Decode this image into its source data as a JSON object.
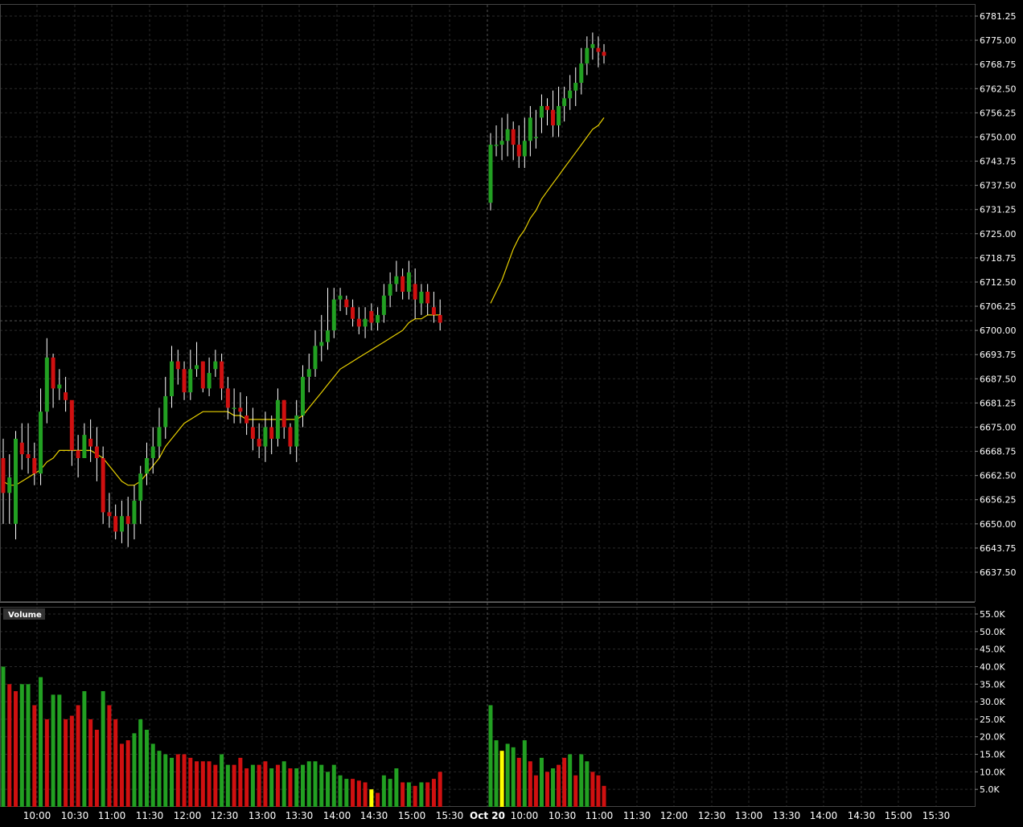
{
  "colors": {
    "background": "#000000",
    "grid": "#2a2a2a",
    "up": "#22a022",
    "down": "#d01010",
    "volume_highlight": "#ffff00",
    "ma_line": "#e8d000",
    "wick": "#ffffff",
    "crosshair": "#555555"
  },
  "chart_data": [
    {
      "type": "candlestick",
      "ylim": [
        6631.25,
        6784.375
      ],
      "yticks": [
        "6781.25",
        "6775.00",
        "6768.75",
        "6762.50",
        "6756.25",
        "6750.00",
        "6743.75",
        "6737.50",
        "6731.25",
        "6725.00",
        "6718.75",
        "6712.50",
        "6706.25",
        "6700.00",
        "6693.75",
        "6687.50",
        "6681.25",
        "6675.00",
        "6668.75",
        "6662.50",
        "6656.25",
        "6650.00",
        "6643.75",
        "6637.50"
      ],
      "grid": true,
      "crosshair_price": 6702.5,
      "candles_day1": {
        "open": [
          6667,
          6658,
          6650,
          6671,
          6668,
          6667,
          6663,
          6679,
          6693,
          6685,
          6684,
          6682,
          6669,
          6667,
          6672,
          6670,
          6667,
          6653,
          6652,
          6648,
          6652,
          6650,
          6656,
          6663,
          6667,
          6670,
          6675,
          6683,
          6692,
          6690,
          6684,
          6690,
          6692,
          6685,
          6690,
          6692,
          6685,
          6680,
          6680,
          6678,
          6675,
          6672,
          6670,
          6675,
          6672,
          6682,
          6675,
          6670,
          6678,
          6688,
          6690,
          6696,
          6697,
          6700,
          6708,
          6708,
          6706,
          6703,
          6701,
          6705,
          6702,
          6704,
          6709,
          6712,
          6714,
          6710,
          6712,
          6707,
          6710,
          6706,
          6704
        ],
        "close": [
          6658,
          6662,
          6672,
          6668,
          6667,
          6663,
          6679,
          6693,
          6685,
          6686,
          6682,
          6669,
          6667,
          6673,
          6670,
          6667,
          6653,
          6652,
          6648,
          6652,
          6650,
          6656,
          6663,
          6667,
          6670,
          6675,
          6683,
          6692,
          6690,
          6684,
          6690,
          6691,
          6685,
          6689,
          6692,
          6685,
          6680,
          6680,
          6679,
          6676,
          6672,
          6670,
          6675,
          6672,
          6682,
          6675,
          6670,
          6678,
          6688,
          6690,
          6696,
          6697,
          6700,
          6708,
          6709,
          6706,
          6703,
          6701,
          6703,
          6702,
          6704,
          6709,
          6712,
          6714,
          6710,
          6715,
          6708,
          6710,
          6707,
          6704,
          6702
        ],
        "high": [
          6672,
          6668,
          6674,
          6676,
          6676,
          6671,
          6685,
          6698,
          6694,
          6690,
          6688,
          6675,
          6673,
          6676,
          6677,
          6675,
          6670,
          6658,
          6655,
          6656,
          6657,
          6660,
          6665,
          6671,
          6675,
          6680,
          6688,
          6696,
          6695,
          6692,
          6695,
          6697,
          6692,
          6693,
          6695,
          6694,
          6688,
          6685,
          6684,
          6683,
          6680,
          6676,
          6679,
          6678,
          6685,
          6682,
          6676,
          6682,
          6691,
          6694,
          6700,
          6704,
          6711,
          6711,
          6711,
          6709,
          6708,
          6706,
          6706,
          6707,
          6706,
          6712,
          6715,
          6718,
          6716,
          6718,
          6716,
          6712,
          6712,
          6710,
          6708
        ],
        "low": [
          6650,
          6650,
          6646,
          6664,
          6663,
          6660,
          6660,
          6676,
          6680,
          6682,
          6679,
          6665,
          6662,
          6667,
          6666,
          6661,
          6650,
          6649,
          6646,
          6645,
          6644,
          6646,
          6650,
          6660,
          6663,
          6667,
          6672,
          6680,
          6686,
          6682,
          6682,
          6688,
          6684,
          6683,
          6688,
          6682,
          6677,
          6676,
          6676,
          6673,
          6669,
          6667,
          6666,
          6668,
          6670,
          6672,
          6668,
          6666,
          6675,
          6684,
          6688,
          6692,
          6695,
          6698,
          6705,
          6704,
          6701,
          6699,
          6698,
          6700,
          6700,
          6702,
          6706,
          6710,
          6708,
          6708,
          6703,
          6704,
          6704,
          6702,
          6700
        ]
      },
      "candles_day2": {
        "open": [
          6733,
          6748,
          6748,
          6749,
          6752,
          6748,
          6745,
          6749,
          6750,
          6755,
          6758,
          6757,
          6753,
          6758,
          6760,
          6762,
          6764,
          6769,
          6773,
          6773,
          6772
        ],
        "close": [
          6748,
          6748,
          6749,
          6752,
          6748,
          6745,
          6749,
          6755,
          6750,
          6758,
          6757,
          6753,
          6758,
          6760,
          6762,
          6764,
          6769,
          6773,
          6774,
          6772,
          6771
        ],
        "high": [
          6751,
          6753,
          6755,
          6756,
          6754,
          6753,
          6755,
          6758,
          6757,
          6761,
          6760,
          6762,
          6763,
          6763,
          6766,
          6768,
          6773,
          6776,
          6777,
          6776,
          6774
        ],
        "low": [
          6731,
          6745,
          6744,
          6745,
          6744,
          6742,
          6742,
          6745,
          6747,
          6751,
          6753,
          6750,
          6750,
          6754,
          6757,
          6758,
          6761,
          6766,
          6770,
          6768,
          6769
        ]
      },
      "moving_average_day1": [
        6661,
        6660,
        6660,
        6661,
        6662,
        6663,
        6664,
        6666,
        6667,
        6669,
        6669,
        6669,
        6669,
        6669,
        6669,
        6668,
        6667,
        6665,
        6663,
        6661,
        6660,
        6660,
        6661,
        6663,
        6665,
        6667,
        6670,
        6672,
        6674,
        6676,
        6677,
        6678,
        6679,
        6679,
        6679,
        6679,
        6679,
        6678,
        6678,
        6677,
        6677,
        6677,
        6677,
        6677,
        6677,
        6677,
        6677,
        6677,
        6678,
        6680,
        6682,
        6684,
        6686,
        6688,
        6690,
        6691,
        6692,
        6693,
        6694,
        6695,
        6696,
        6697,
        6698,
        6699,
        6700,
        6702,
        6703,
        6703,
        6704,
        6704,
        6704
      ],
      "moving_average_day2": [
        6707,
        6710,
        6713,
        6717,
        6721,
        6724,
        6726,
        6729,
        6731,
        6734,
        6736,
        6738,
        6740,
        6742,
        6744,
        6746,
        6748,
        6750,
        6752,
        6753,
        6755
      ]
    },
    {
      "type": "bar",
      "legend": "Volume",
      "ylim": [
        0,
        57500
      ],
      "yticks": [
        "55.0K",
        "50.0K",
        "45.0K",
        "40.0K",
        "35.0K",
        "30.0K",
        "25.0K",
        "20.0K",
        "15.0K",
        "10.0K",
        "5.0K"
      ],
      "volume_day1": [
        40000,
        35000,
        33000,
        35000,
        35000,
        29000,
        37000,
        25000,
        32000,
        32000,
        25000,
        26000,
        29000,
        33000,
        25000,
        22000,
        33000,
        29000,
        25000,
        18000,
        19000,
        21000,
        25000,
        22000,
        18000,
        16000,
        15000,
        14000,
        15000,
        15000,
        14000,
        13000,
        13000,
        13000,
        12000,
        15000,
        12000,
        12000,
        14000,
        11000,
        12000,
        12000,
        13000,
        11000,
        12000,
        13000,
        11000,
        11000,
        12000,
        13000,
        13000,
        12000,
        10000,
        12000,
        9000,
        8000,
        8000,
        7500,
        7000,
        5000,
        4000,
        9000,
        8000,
        11000,
        7000,
        7000,
        6000,
        7000,
        7000,
        8000,
        10000
      ],
      "volume_day2": [
        29000,
        19000,
        16000,
        18000,
        17000,
        14000,
        19000,
        13000,
        9000,
        14000,
        10000,
        11000,
        12000,
        14000,
        15000,
        9000,
        15000,
        13000,
        10000,
        9000,
        6000
      ],
      "volume_colors_day1": [
        "up",
        "down",
        "down",
        "up",
        "up",
        "down",
        "up",
        "down",
        "up",
        "up",
        "down",
        "down",
        "down",
        "up",
        "down",
        "down",
        "up",
        "down",
        "down",
        "down",
        "down",
        "up",
        "up",
        "up",
        "up",
        "up",
        "up",
        "up",
        "down",
        "down",
        "down",
        "down",
        "down",
        "down",
        "down",
        "up",
        "up",
        "down",
        "down",
        "down",
        "up",
        "down",
        "down",
        "up",
        "down",
        "up",
        "down",
        "up",
        "up",
        "up",
        "up",
        "up",
        "up",
        "up",
        "up",
        "up",
        "down",
        "down",
        "down",
        "highlight",
        "down",
        "up",
        "up",
        "up",
        "down",
        "up",
        "down",
        "up",
        "down",
        "down",
        "down"
      ],
      "volume_colors_day2": [
        "up",
        "up",
        "highlight",
        "up",
        "up",
        "down",
        "up",
        "down",
        "down",
        "up",
        "down",
        "up",
        "down",
        "down",
        "up",
        "down",
        "up",
        "up",
        "down",
        "down",
        "down"
      ]
    }
  ],
  "time_axis": {
    "labels": [
      "10:00",
      "10:30",
      "11:00",
      "11:30",
      "12:00",
      "12:30",
      "13:00",
      "13:30",
      "14:00",
      "14:30",
      "15:00",
      "15:30",
      "Oct 20",
      "10:00",
      "10:30",
      "11:00",
      "11:30",
      "12:00",
      "12:30",
      "13:00",
      "13:30",
      "14:00",
      "14:30",
      "15:00",
      "15:30"
    ],
    "bold_index": 12
  }
}
